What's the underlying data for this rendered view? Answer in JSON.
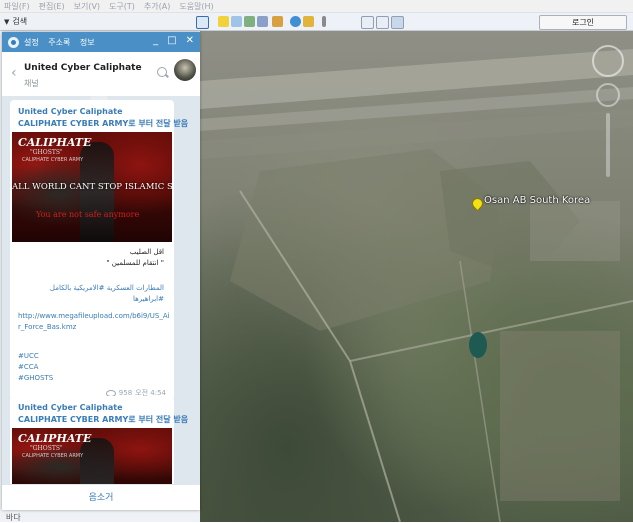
{
  "menu": [
    "파일(F)",
    "편집(E)",
    "보기(V)",
    "도구(T)",
    "추가(A)",
    "도움말(H)"
  ],
  "search": {
    "label": "검색"
  },
  "toolbar": {
    "icons": [
      "sidebar-icon",
      "placemark-icon",
      "polygon-icon",
      "path-icon",
      "overlay-icon",
      "tour-icon",
      "sky-icon",
      "sun-icon",
      "ruler-icon",
      "email-icon",
      "print-icon",
      "map-icon"
    ],
    "login_label": "로그인"
  },
  "map": {
    "placemark_label": "Osan AB South Korea"
  },
  "sidebar_bottom": "바다",
  "telegram": {
    "menu": [
      "설정",
      "주소록",
      "정보"
    ],
    "window_buttons": [
      "_",
      "□",
      "✕"
    ],
    "channel": {
      "name": "United Cyber Caliphate",
      "subtitle": "채널"
    },
    "messages": [
      {
        "sender": "United Cyber Caliphate",
        "forwarded": "CALIPHATE CYBER ARMY로 부터 전달 받음",
        "image": {
          "title": "CALIPHATE",
          "subtitle": "\"GHOSTS\"",
          "subtitle2": "CALIPHATE CYBER ARMY",
          "banner": "ALL WORLD CANT STOP ISLAMIC STATE",
          "red_text": "You are not safe anymore"
        },
        "arabic_lines": [
          "اقل الصليب",
          "\" انتقام للمسلمين \"",
          "",
          "المطارات العسكرية #الامريكية بالكامل",
          "#ابراهيرها"
        ],
        "link": "http://www.megafileupload.com/b6i9/US_Air_Force_Bas.kmz",
        "hashtags": [
          "#UCC",
          "#CCA",
          "#GHOSTS"
        ],
        "views": "958",
        "time": "오전 4:54"
      },
      {
        "sender": "United Cyber Caliphate",
        "forwarded": "CALIPHATE CYBER ARMY로 부터 전달 받음",
        "image": {
          "title": "CALIPHATE",
          "subtitle": "\"GHOSTS\"",
          "subtitle2": "CALIPHATE CYBER ARMY"
        }
      }
    ],
    "footer_label": "음소거"
  }
}
